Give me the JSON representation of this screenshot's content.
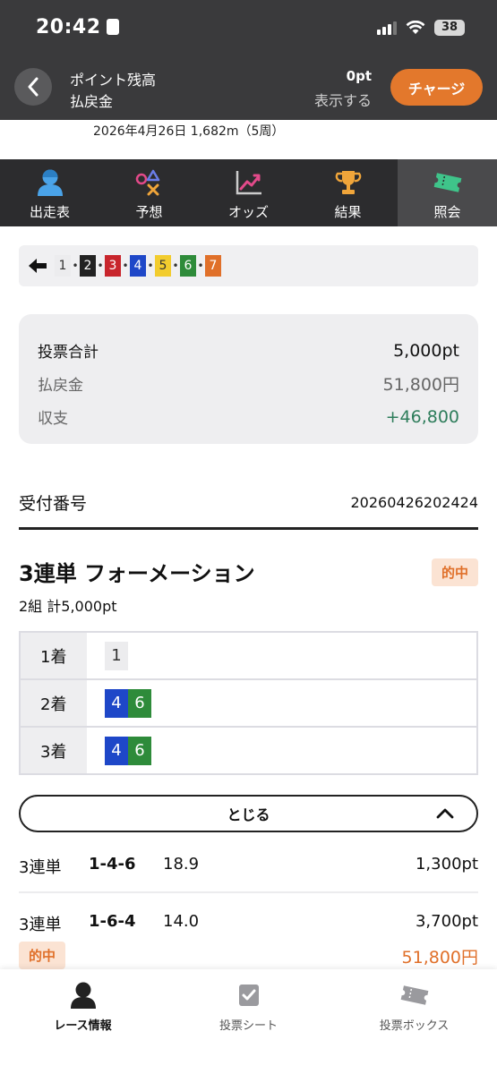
{
  "status_bar": {
    "time": "20:42",
    "battery": "38"
  },
  "header": {
    "points_label": "ポイント残高",
    "payout_label": "払戻金",
    "points_value": "0pt",
    "show_label": "表示する",
    "charge_button": "チャージ"
  },
  "race_info": {
    "date_line": "2026年4月26日 1,682m（5周）"
  },
  "tabs": [
    {
      "label": "出走表",
      "icon": "racer-icon"
    },
    {
      "label": "予想",
      "icon": "prediction-icon"
    },
    {
      "label": "オッズ",
      "icon": "odds-chart-icon"
    },
    {
      "label": "結果",
      "icon": "trophy-icon"
    },
    {
      "label": "照会",
      "icon": "ticket-icon",
      "active": true
    }
  ],
  "frame_strip": {
    "numbers": [
      "1",
      "2",
      "3",
      "4",
      "5",
      "6",
      "7"
    ],
    "colors": [
      "#ececee",
      "#222222",
      "#c8252c",
      "#1e47c8",
      "#f2cc2e",
      "#2e8b3a",
      "#e0702a"
    ]
  },
  "summary": {
    "total_label": "投票合計",
    "total_value": "5,000pt",
    "payout_label": "払戻金",
    "payout_value": "51,800円",
    "balance_label": "収支",
    "balance_value": "+46,800"
  },
  "receipt": {
    "label": "受付番号",
    "number": "20260426202424"
  },
  "bet": {
    "title": "3連単 フォーメーション",
    "hit_badge": "的中",
    "subtitle": "2組 計5,000pt",
    "formation": [
      {
        "position": "1着",
        "numbers": [
          "1"
        ]
      },
      {
        "position": "2着",
        "numbers": [
          "4",
          "6"
        ]
      },
      {
        "position": "3着",
        "numbers": [
          "4",
          "6"
        ]
      }
    ],
    "close_button": "とじる"
  },
  "results": [
    {
      "type": "3連単",
      "combo": "1-4-6",
      "odds": "18.9",
      "amount": "1,300pt"
    },
    {
      "type": "3連単",
      "combo": "1-6-4",
      "odds": "14.0",
      "amount": "3,700pt",
      "hit_badge": "的中",
      "payout": "51,800円"
    }
  ],
  "bottom_nav": [
    {
      "label": "レース情報",
      "icon": "racer-icon",
      "active": true
    },
    {
      "label": "投票シート",
      "icon": "checkbox-icon"
    },
    {
      "label": "投票ボックス",
      "icon": "ticket-icon"
    }
  ]
}
